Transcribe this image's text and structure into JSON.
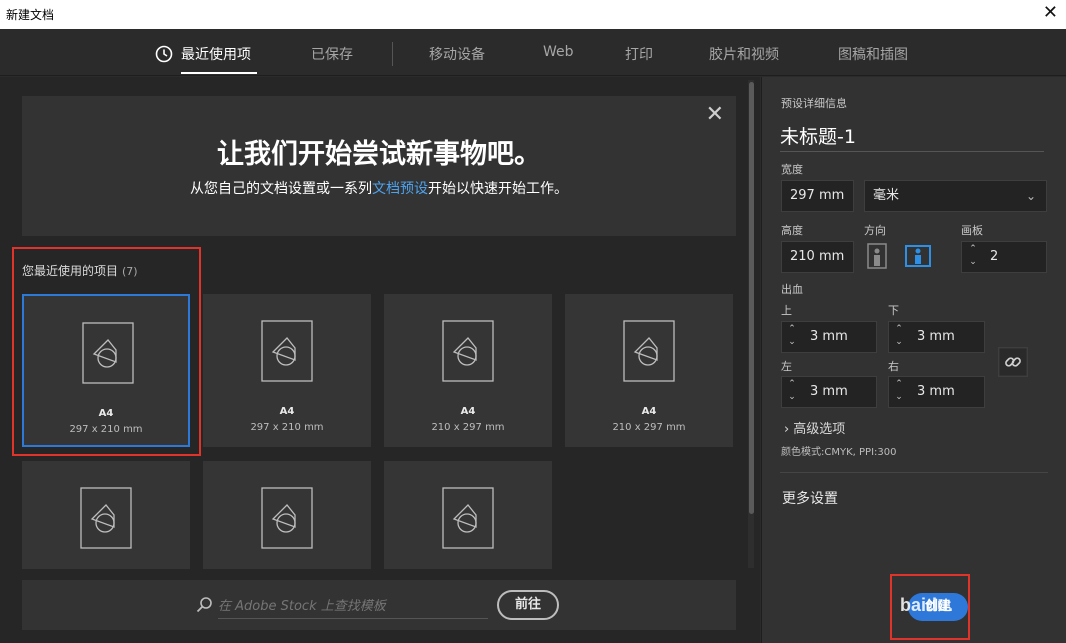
{
  "window": {
    "title": "新建文档",
    "close_glyph": "✕"
  },
  "tabs": [
    {
      "label": "最近使用项",
      "active": true
    },
    {
      "label": "已保存"
    },
    {
      "label": "移动设备"
    },
    {
      "label": "Web"
    },
    {
      "label": "打印"
    },
    {
      "label": "胶片和视频"
    },
    {
      "label": "图稿和插图"
    }
  ],
  "hero": {
    "title": "让我们开始尝试新事物吧。",
    "sub_before": "从您自己的文档设置或一系列",
    "sub_link": "文档预设",
    "sub_after": "开始以快速开始工作。",
    "close_glyph": "✕"
  },
  "recent": {
    "label": "您最近使用的项目",
    "count": "(7)"
  },
  "cards": [
    {
      "name": "A4",
      "size": "297 x 210 mm"
    },
    {
      "name": "A4",
      "size": "297 x 210 mm"
    },
    {
      "name": "A4",
      "size": "210 x 297 mm"
    },
    {
      "name": "A4",
      "size": "210 x 297 mm"
    },
    {
      "name": "",
      "size": ""
    },
    {
      "name": "",
      "size": ""
    },
    {
      "name": "",
      "size": ""
    }
  ],
  "search": {
    "placeholder": "在 Adobe Stock 上查找模板",
    "go_label": "前往"
  },
  "preset": {
    "section_label": "预设详细信息",
    "doc_name": "未标题-1",
    "width_label": "宽度",
    "width_value": "297 mm",
    "unit_value": "毫米",
    "height_label": "高度",
    "height_value": "210 mm",
    "orientation_label": "方向",
    "artboards_label": "画板",
    "artboards_value": "2",
    "bleed_label": "出血",
    "top_label": "上",
    "top_value": "3 mm",
    "bottom_label": "下",
    "bottom_value": "3 mm",
    "left_label": "左",
    "left_value": "3 mm",
    "right_label": "右",
    "right_value": "3 mm",
    "advanced_label": "高级选项",
    "color_mode": "颜色模式:CMYK, PPI:300",
    "more_label": "更多设置",
    "create_label": "创建"
  },
  "watermark": "baidu.",
  "colors": {
    "accent": "#2d78d9",
    "highlight": "#e0342a",
    "link": "#4ea3ef"
  }
}
